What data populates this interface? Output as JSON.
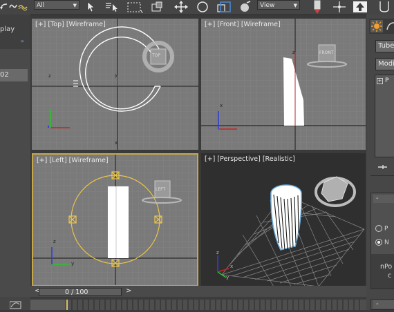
{
  "toolbar": {
    "selection_filter": "All",
    "reference_coord": "View",
    "icons": [
      "undo-icon",
      "link-icon",
      "bind-space-warp-icon",
      "select-object-icon",
      "select-by-name-icon",
      "rect-selection-region-icon",
      "window-crossing-icon",
      "select-and-move-icon",
      "select-and-rotate-icon",
      "select-and-scale-icon",
      "select-and-place-icon",
      "use-pivot-center-icon",
      "select-manipulate-icon",
      "snaps-toggle-icon",
      "mirror-icon"
    ]
  },
  "left_panel": {
    "header_label": "play",
    "expand_glyph": "»",
    "selected_item": "02"
  },
  "viewports": {
    "top": {
      "label_parts": [
        "[+]",
        "[Top]",
        "[Wireframe]"
      ],
      "cube_face": "TOP",
      "axis_x": "x",
      "axis_y": "y",
      "axis_z": "z"
    },
    "front": {
      "label_parts": [
        "[+]",
        "[Front]",
        "[Wireframe]"
      ],
      "cube_face": "FRONT",
      "axis_x": "x",
      "axis_z": "z"
    },
    "left": {
      "label_parts": [
        "[+]",
        "[Left]",
        "[Wireframe]"
      ],
      "cube_face": "LEFT",
      "axis_y": "y",
      "axis_z": "z"
    },
    "perspective": {
      "label_parts": [
        "[+]",
        "[Perspective]",
        "[Realistic]"
      ],
      "axis_x": "x",
      "axis_y": "y",
      "axis_z": "z"
    }
  },
  "right_panel": {
    "object_name": "Tube",
    "modifier_list": "Modif",
    "stack_item": "P",
    "radio_options": [
      "P",
      "N"
    ],
    "rollout_text_1": "nPo",
    "rollout_text_2": "c",
    "collapse_glyph": "-"
  },
  "timeline": {
    "frame_display": "0 / 100",
    "prev_glyph": "<",
    "next_glyph": ">"
  },
  "colors": {
    "viewport_bg": "#7a7a7a",
    "viewport_dark_bg": "#2f2f2f",
    "active_border": "#c6a84a",
    "grid_minor": "#8a8a8a",
    "grid_major": "#2a2a2a",
    "selection_yellow": "#ecc64a",
    "object_white": "#ffffff",
    "ui_dark": "#3a3a3a"
  }
}
